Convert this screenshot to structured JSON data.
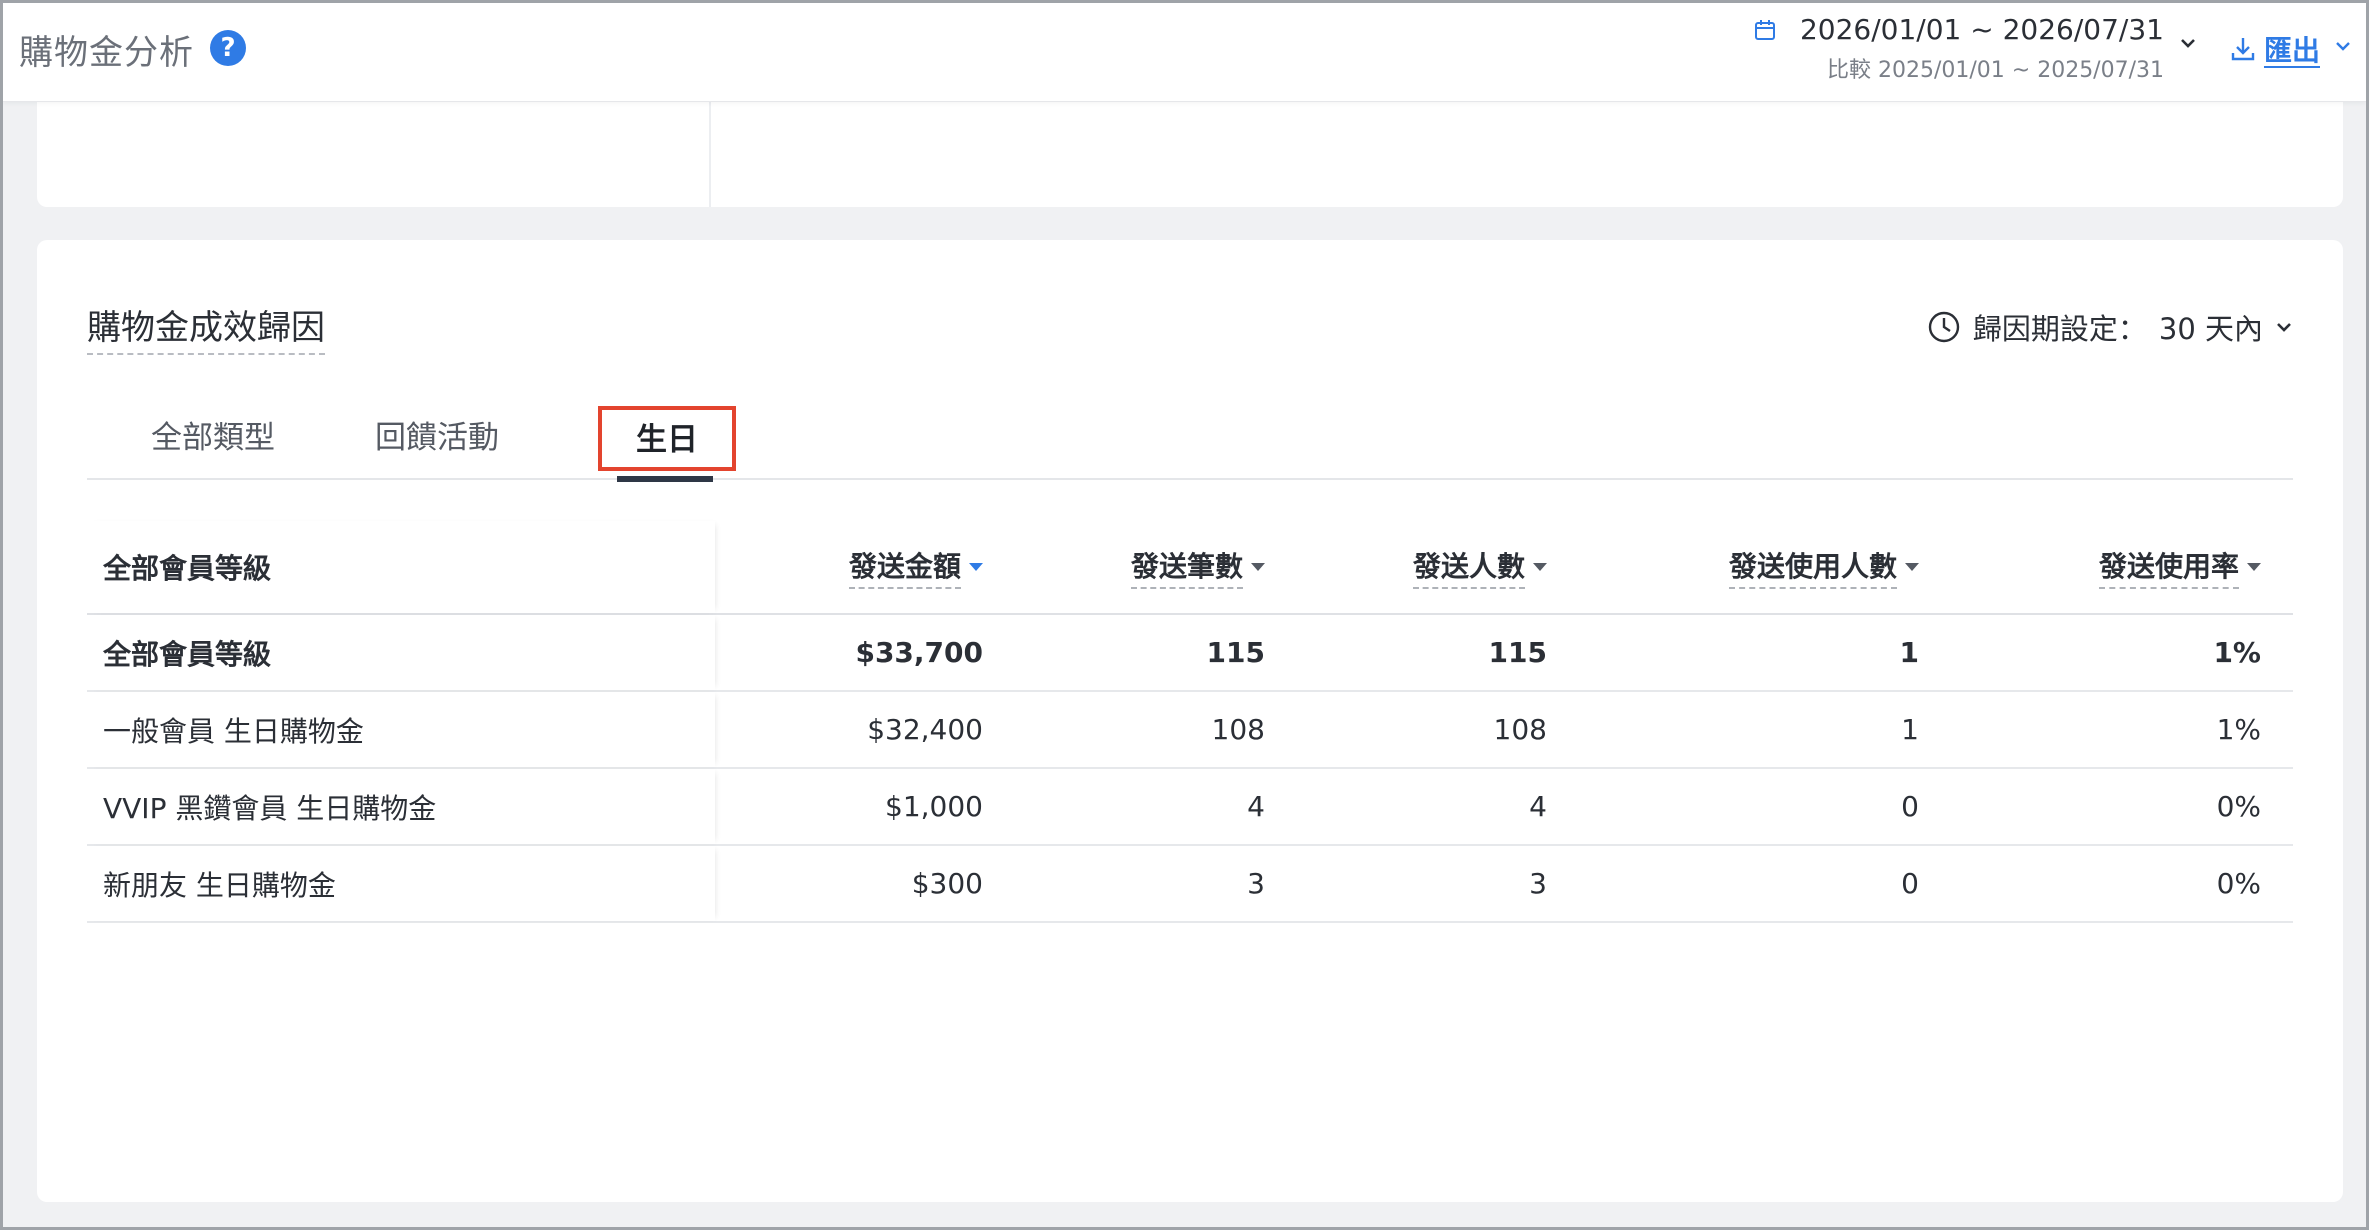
{
  "header": {
    "title": "購物金分析",
    "help_icon": "question-circle-icon",
    "date_range": "2026/01/01 ~ 2026/07/31",
    "compare_range": "比較 2025/01/01 ~ 2025/07/31",
    "export_label": "匯出"
  },
  "section": {
    "title": "購物金成效歸因",
    "period_label": "歸因期設定：",
    "period_value": "30 天內"
  },
  "tabs": [
    {
      "label": "全部類型",
      "active": false
    },
    {
      "label": "回饋活動",
      "active": false
    },
    {
      "label": "生日",
      "active": true
    }
  ],
  "table": {
    "name_header": "全部會員等級",
    "columns": [
      "發送金額",
      "發送筆數",
      "發送人數",
      "發送使用人數",
      "發送使用率"
    ],
    "rows": [
      {
        "name": "全部會員等級",
        "values": [
          "$33,700",
          "115",
          "115",
          "1",
          "1%"
        ],
        "total": true
      },
      {
        "name": "一般會員 生日購物金",
        "values": [
          "$32,400",
          "108",
          "108",
          "1",
          "1%"
        ]
      },
      {
        "name": "VVIP 黑鑽會員 生日購物金",
        "values": [
          "$1,000",
          "4",
          "4",
          "0",
          "0%"
        ]
      },
      {
        "name": "新朋友 生日購物金",
        "values": [
          "$300",
          "3",
          "3",
          "0",
          "0%"
        ]
      }
    ]
  },
  "colors": {
    "accent": "#2f7be5",
    "highlight_border": "#e3442e",
    "tab_underline": "#2e3746"
  }
}
